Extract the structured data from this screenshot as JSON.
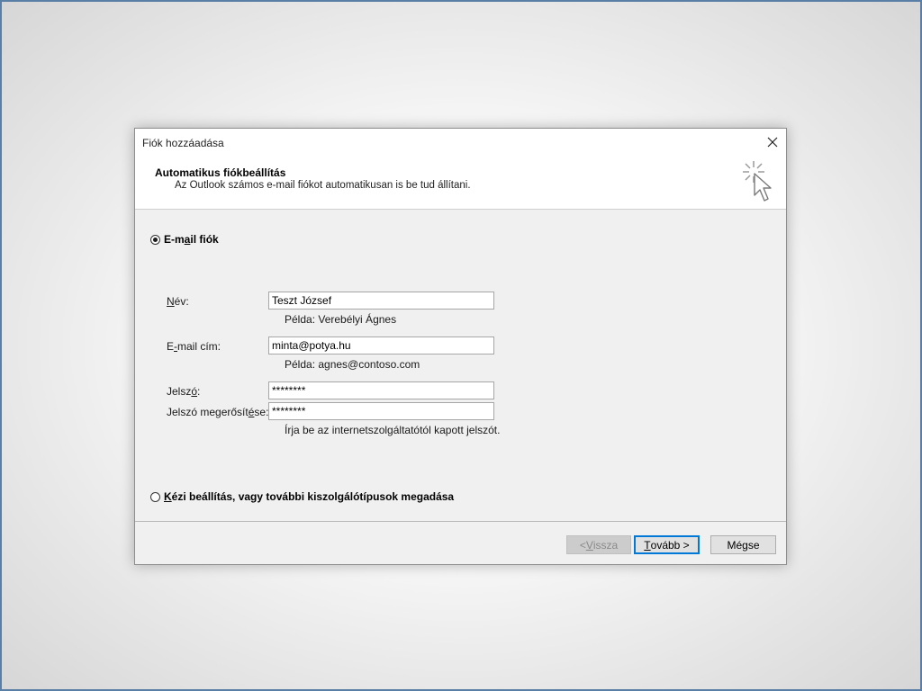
{
  "dialog": {
    "title": "Fiók hozzáadása",
    "header": {
      "title": "Automatikus fiókbeállítás",
      "subtitle": "Az Outlook számos e-mail fiókot automatikusan is be tud állítani."
    },
    "email_account": {
      "radio_label_pre": "E-m",
      "radio_label_key": "a",
      "radio_label_post": "il fiók",
      "selected": true
    },
    "fields": {
      "name": {
        "label_key": "N",
        "label_rest": "év:",
        "value": "Teszt József",
        "hint": "Példa: Verebélyi Ágnes"
      },
      "email": {
        "label_pre": "E",
        "label_key": "-",
        "label_rest": "mail cím:",
        "value": "minta@potya.hu",
        "hint": "Példa: agnes@contoso.com"
      },
      "password": {
        "label_pre": "Jelsz",
        "label_key": "ó",
        "label_rest": ":",
        "value": "********"
      },
      "password_confirm": {
        "label_pre": "Jelszó megerősít",
        "label_key": "é",
        "label_rest": "se:",
        "value": "********",
        "hint": "Írja be az internetszolgáltatótól kapott jelszót."
      }
    },
    "manual": {
      "radio_label_key": "K",
      "radio_label_rest": "ézi beállítás, vagy további kiszolgálótípusok megadása",
      "selected": false
    },
    "buttons": {
      "back_pre": "< ",
      "back_key": "V",
      "back_rest": "issza",
      "next_key": "T",
      "next_rest": "ovább >",
      "cancel": "Mégse"
    }
  }
}
